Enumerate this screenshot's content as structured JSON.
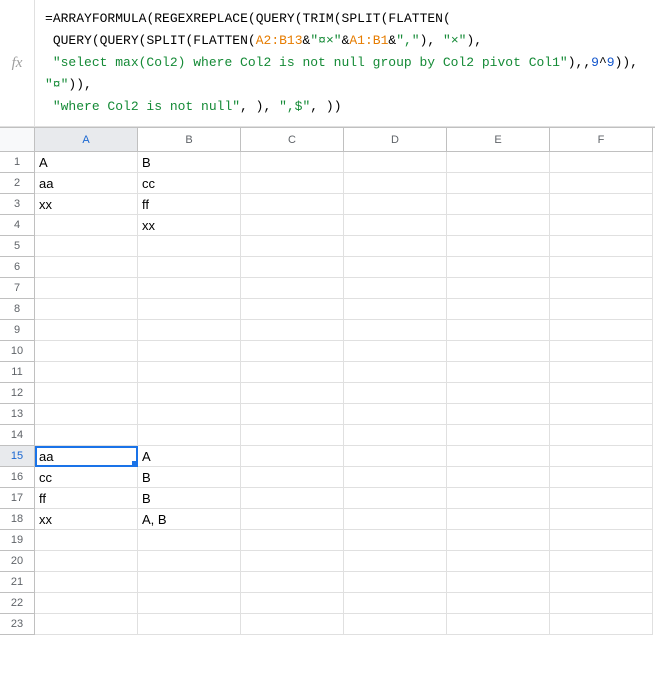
{
  "formula_bar": {
    "fx_label": "fx",
    "formula_parts": [
      {
        "t": "op",
        "v": "="
      },
      {
        "t": "fn",
        "v": "ARRAYFORMULA"
      },
      {
        "t": "paren",
        "v": "("
      },
      {
        "t": "fn",
        "v": "REGEXREPLACE"
      },
      {
        "t": "paren",
        "v": "("
      },
      {
        "t": "fn",
        "v": "QUERY"
      },
      {
        "t": "paren",
        "v": "("
      },
      {
        "t": "fn",
        "v": "TRIM"
      },
      {
        "t": "paren",
        "v": "("
      },
      {
        "t": "fn",
        "v": "SPLIT"
      },
      {
        "t": "paren",
        "v": "("
      },
      {
        "t": "fn",
        "v": "FLATTEN"
      },
      {
        "t": "paren",
        "v": "("
      },
      {
        "t": "br",
        "v": "\n "
      },
      {
        "t": "fn",
        "v": "QUERY"
      },
      {
        "t": "paren",
        "v": "("
      },
      {
        "t": "fn",
        "v": "QUERY"
      },
      {
        "t": "paren",
        "v": "("
      },
      {
        "t": "fn",
        "v": "SPLIT"
      },
      {
        "t": "paren",
        "v": "("
      },
      {
        "t": "fn",
        "v": "FLATTEN"
      },
      {
        "t": "paren",
        "v": "("
      },
      {
        "t": "ref",
        "v": "A2:B13"
      },
      {
        "t": "op",
        "v": "&"
      },
      {
        "t": "str",
        "v": "\"¤×\""
      },
      {
        "t": "op",
        "v": "&"
      },
      {
        "t": "ref",
        "v": "A1:B1"
      },
      {
        "t": "op",
        "v": "&"
      },
      {
        "t": "str",
        "v": "\",\""
      },
      {
        "t": "paren",
        "v": ")"
      },
      {
        "t": "op",
        "v": ", "
      },
      {
        "t": "str",
        "v": "\"×\""
      },
      {
        "t": "paren",
        "v": ")"
      },
      {
        "t": "op",
        "v": ","
      },
      {
        "t": "br",
        "v": "\n "
      },
      {
        "t": "str",
        "v": "\"select max(Col2) where Col2 is not null group by Col2 pivot Col1\""
      },
      {
        "t": "paren",
        "v": ")"
      },
      {
        "t": "op",
        "v": ",,"
      },
      {
        "t": "num",
        "v": "9"
      },
      {
        "t": "op",
        "v": "^"
      },
      {
        "t": "num",
        "v": "9"
      },
      {
        "t": "paren",
        "v": "))"
      },
      {
        "t": "op",
        "v": ", "
      },
      {
        "t": "str",
        "v": "\"¤\""
      },
      {
        "t": "paren",
        "v": "))"
      },
      {
        "t": "op",
        "v": ","
      },
      {
        "t": "br",
        "v": "\n "
      },
      {
        "t": "str",
        "v": "\"where Col2 is not null\""
      },
      {
        "t": "op",
        "v": ", "
      },
      {
        "t": "paren",
        "v": ")"
      },
      {
        "t": "op",
        "v": ", "
      },
      {
        "t": "str",
        "v": "\",$\""
      },
      {
        "t": "op",
        "v": ", "
      },
      {
        "t": "paren",
        "v": "))"
      }
    ]
  },
  "columns": [
    "A",
    "B",
    "C",
    "D",
    "E",
    "F"
  ],
  "rows": 23,
  "selected_cell": {
    "row": 15,
    "col": 0
  },
  "cells": {
    "1": {
      "0": "A",
      "1": "B"
    },
    "2": {
      "0": "aa",
      "1": "cc"
    },
    "3": {
      "0": "xx",
      "1": "ff"
    },
    "4": {
      "1": "xx"
    },
    "15": {
      "0": "aa",
      "1": "A"
    },
    "16": {
      "0": "cc",
      "1": "B"
    },
    "17": {
      "0": "ff",
      "1": "B"
    },
    "18": {
      "0": "xx",
      "1": "A, B"
    }
  }
}
